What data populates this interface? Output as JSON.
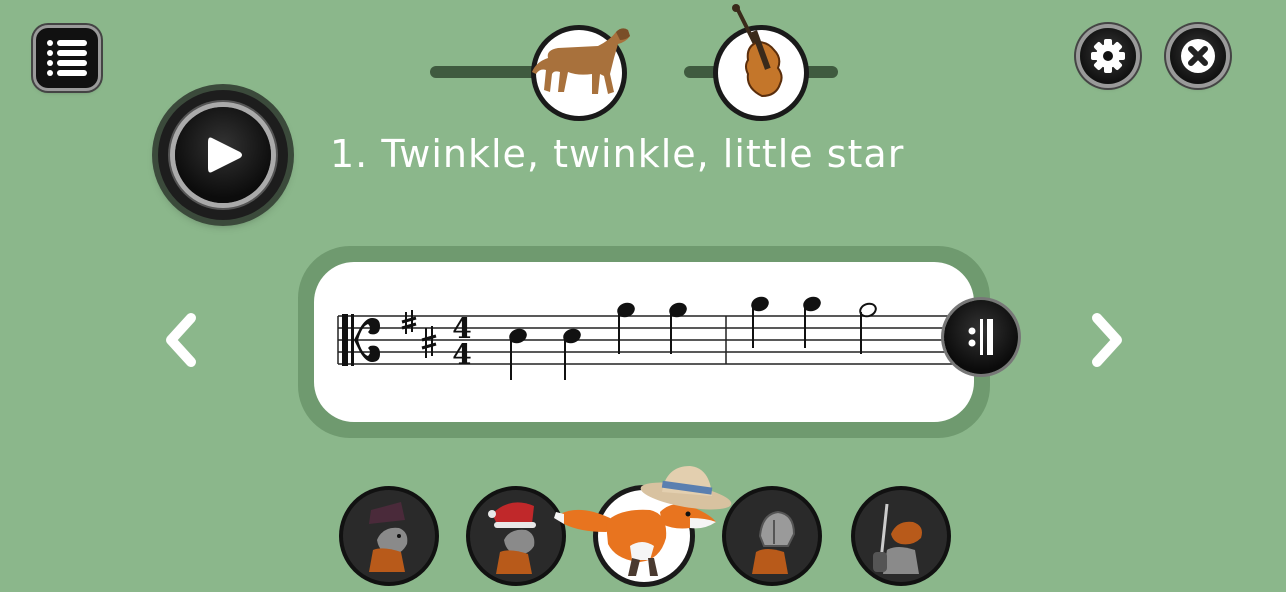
{
  "header": {
    "menu_icon": "list-icon",
    "settings_icon": "gear-icon",
    "close_icon": "close-x-icon"
  },
  "selectors": {
    "animal": {
      "icon": "lion-icon",
      "level": 1.0
    },
    "instrument": {
      "icon": "violin-icon",
      "level": 0.3
    }
  },
  "song": {
    "title": "1. Twinkle, twinkle, little star"
  },
  "score": {
    "clef": "alto-clef",
    "key_signature": "2 sharps",
    "time_signature": {
      "top": "4",
      "bottom": "4"
    },
    "repeat_icon": "repeat-end-icon"
  },
  "navigation": {
    "prev_icon": "chevron-left-icon",
    "next_icon": "chevron-right-icon"
  },
  "characters": [
    {
      "name": "fox-witch-hat",
      "selected": false
    },
    {
      "name": "fox-santa-hat",
      "selected": false
    },
    {
      "name": "fox-straw-hat",
      "selected": true
    },
    {
      "name": "fox-helmet",
      "selected": false
    },
    {
      "name": "fox-guitar",
      "selected": false
    }
  ],
  "colors": {
    "background": "#8bb78b",
    "card": "#ffffff",
    "button": "#111111",
    "fox": "#e8741f"
  }
}
